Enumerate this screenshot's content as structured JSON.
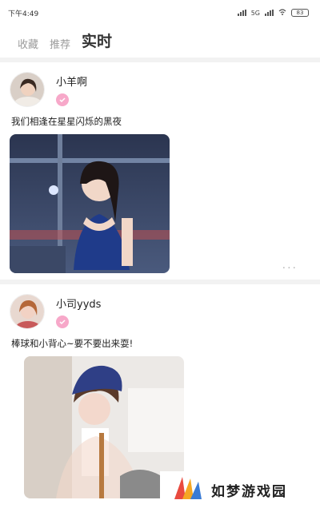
{
  "status_bar": {
    "time": "下午4:49",
    "network": "5G",
    "battery": "83"
  },
  "tabs": [
    {
      "label": "收藏",
      "active": false
    },
    {
      "label": "推荐",
      "active": false
    },
    {
      "label": "实时",
      "active": true
    }
  ],
  "posts": [
    {
      "username": "小羊啊",
      "text": "我们相逢在星星闪烁的黑夜",
      "more": "..."
    },
    {
      "username": "小司yyds",
      "text": "棒球和小背心~要不要出来耍!",
      "more": "..."
    }
  ],
  "watermark": {
    "text": "如梦游戏园",
    "colors": [
      "#e94a3f",
      "#f5a623",
      "#3a7bd5"
    ]
  },
  "colors": {
    "accent": "#ff5a8a",
    "badge": "#f7a8c9"
  }
}
